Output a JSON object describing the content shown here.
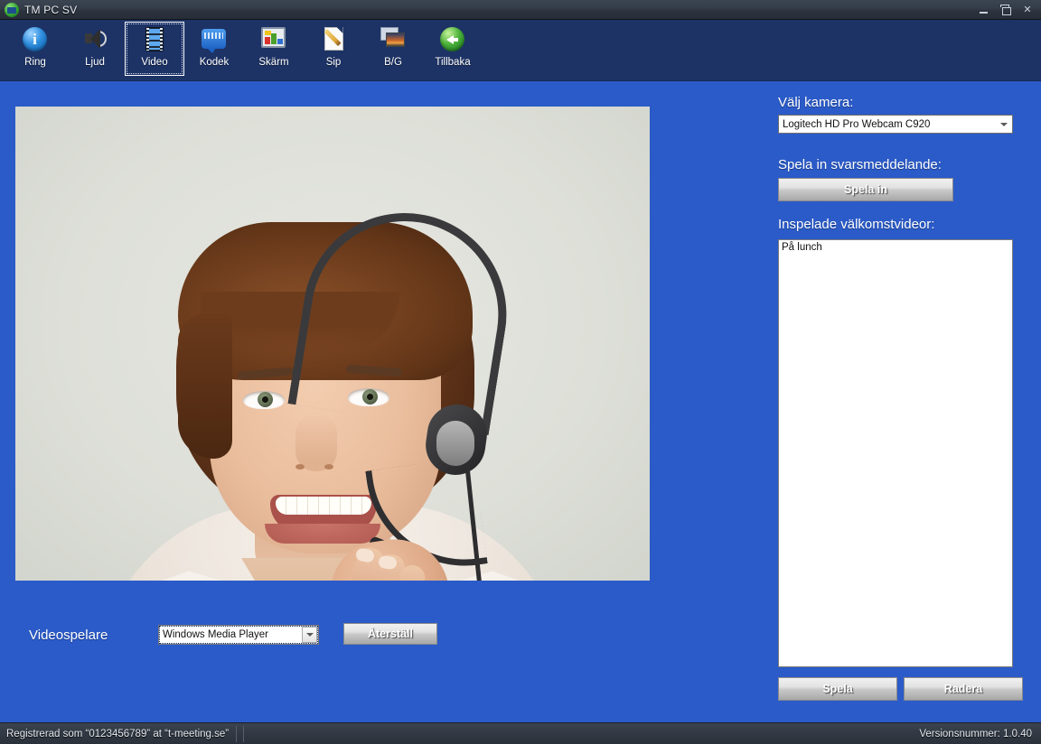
{
  "window": {
    "title": "TM PC SV",
    "app_icon": "tm-app-icon",
    "controls": {
      "minimize": "minimize-icon",
      "restore": "restore-icon",
      "close": "✕"
    }
  },
  "toolbar": {
    "items": [
      {
        "label": "Ring",
        "icon": "info-circle-icon",
        "selected": false
      },
      {
        "label": "Ljud",
        "icon": "speaker-icon",
        "selected": false
      },
      {
        "label": "Video",
        "icon": "film-strip-icon",
        "selected": true
      },
      {
        "label": "Kodek",
        "icon": "code-bubble-icon",
        "selected": false
      },
      {
        "label": "Skärm",
        "icon": "screen-icon",
        "selected": false
      },
      {
        "label": "Sip",
        "icon": "page-pencil-icon",
        "selected": false
      },
      {
        "label": "B/G",
        "icon": "background-image-icon",
        "selected": false
      },
      {
        "label": "Tillbaka",
        "icon": "green-back-arrow-icon",
        "selected": false
      }
    ]
  },
  "preview": {
    "description": "Kameraförhandsvisning: leende kvinna med headset",
    "background_color": "#dfdfda"
  },
  "player_row": {
    "label": "Videospelare",
    "select_value": "Windows Media Player",
    "reset_label": "Återställ"
  },
  "right_panel": {
    "camera_label": "Välj kamera:",
    "camera_value": "Logitech HD Pro Webcam C920",
    "record_label": "Spela in svarsmeddelande:",
    "record_button": "Spela in",
    "list_label": "Inspelade välkomstvideor:",
    "list_items": [
      "På lunch"
    ],
    "play_button": "Spela",
    "delete_button": "Radera"
  },
  "statusbar": {
    "left": "Registrerad som “0123456789” at “t-meeting.se”",
    "right": "Versionsnummer: 1.0.40"
  },
  "colors": {
    "toolbar_bg": "#1d3366",
    "main_bg": "#2b5bc8",
    "titlebar_bg": "#333c48",
    "statusbar_bg": "#333b46"
  }
}
